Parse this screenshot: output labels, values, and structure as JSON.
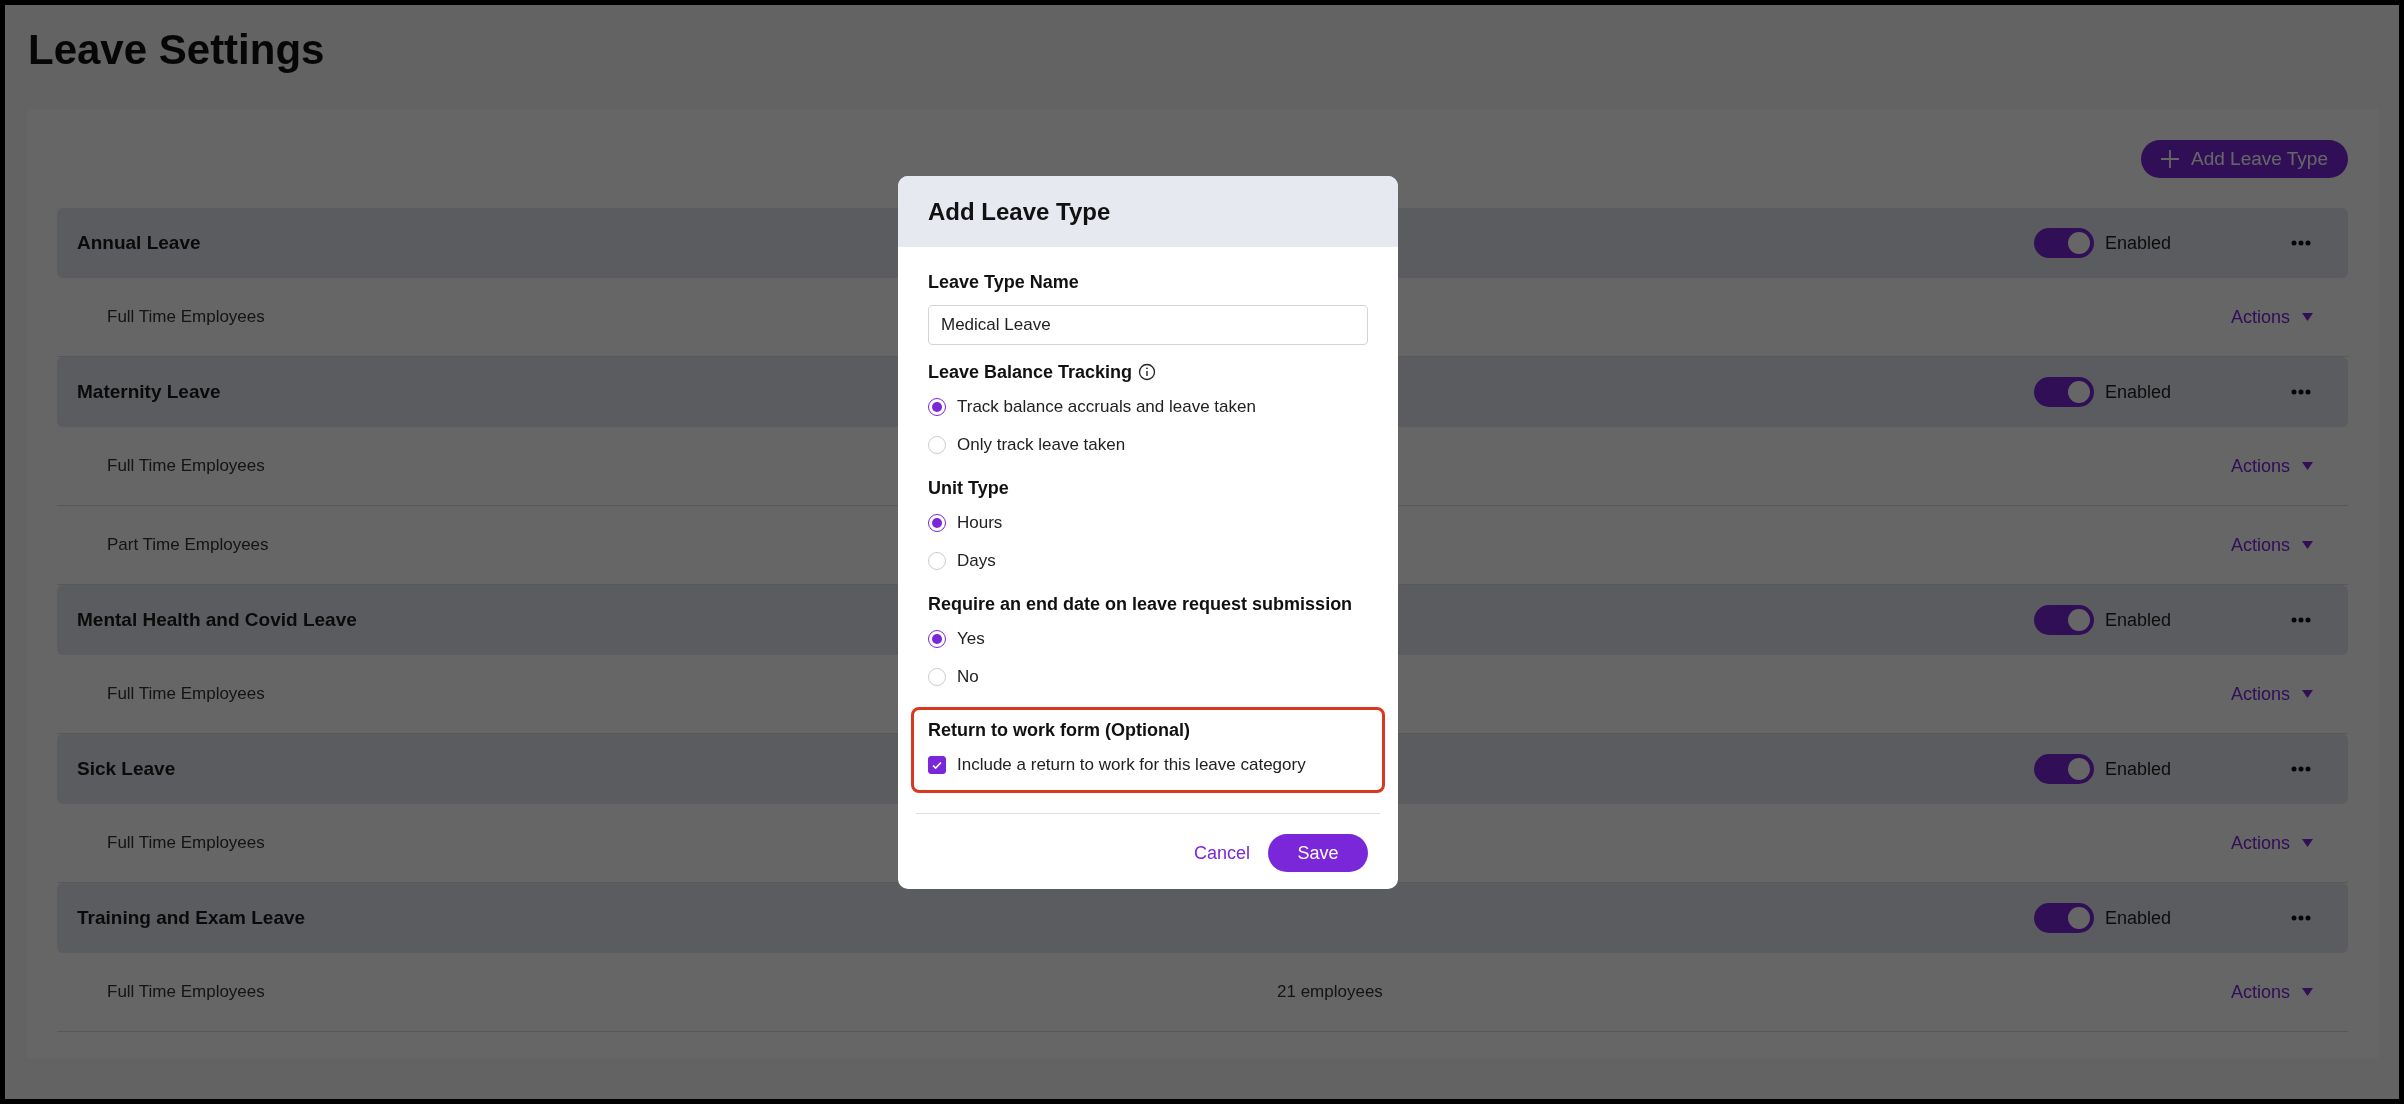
{
  "page": {
    "title": "Leave Settings"
  },
  "add_button": {
    "label": "Add Leave Type"
  },
  "leave_types": [
    {
      "name": "Annual Leave",
      "enabled": true,
      "status": "Enabled",
      "groups": [
        {
          "name": "Full Time Employees",
          "action": "Actions"
        }
      ]
    },
    {
      "name": "Maternity Leave",
      "enabled": true,
      "status": "Enabled",
      "groups": [
        {
          "name": "Full Time Employees",
          "action": "Actions"
        },
        {
          "name": "Part Time Employees",
          "action": "Actions"
        }
      ]
    },
    {
      "name": "Mental Health and Covid Leave",
      "enabled": true,
      "status": "Enabled",
      "groups": [
        {
          "name": "Full Time Employees",
          "action": "Actions"
        }
      ]
    },
    {
      "name": "Sick Leave",
      "enabled": true,
      "status": "Enabled",
      "groups": [
        {
          "name": "Full Time Employees",
          "action": "Actions"
        }
      ]
    },
    {
      "name": "Training and Exam Leave",
      "enabled": true,
      "status": "Enabled",
      "groups": [
        {
          "name": "Full Time Employees",
          "count": "21 employees",
          "action": "Actions"
        }
      ]
    }
  ],
  "modal": {
    "title": "Add Leave Type",
    "sections": [
      {
        "kind": "text",
        "label": "Leave Type Name",
        "value": "Medical Leave"
      },
      {
        "kind": "radio",
        "label": "Leave Balance Tracking",
        "info_icon": true,
        "options": [
          {
            "label": "Track balance accruals and leave taken",
            "selected": true
          },
          {
            "label": "Only track leave taken",
            "selected": false
          }
        ]
      },
      {
        "kind": "radio",
        "label": "Unit Type",
        "options": [
          {
            "label": "Hours",
            "selected": true
          },
          {
            "label": "Days",
            "selected": false
          }
        ]
      },
      {
        "kind": "radio",
        "label": "Require an end date on leave request submission",
        "options": [
          {
            "label": "Yes",
            "selected": true
          },
          {
            "label": "No",
            "selected": false
          }
        ]
      },
      {
        "kind": "checkbox",
        "label": "Return to work form (Optional)",
        "highlighted": true,
        "options": [
          {
            "label": "Include a return to work for this leave category",
            "checked": true
          }
        ]
      }
    ],
    "cancel": "Cancel",
    "save": "Save"
  }
}
